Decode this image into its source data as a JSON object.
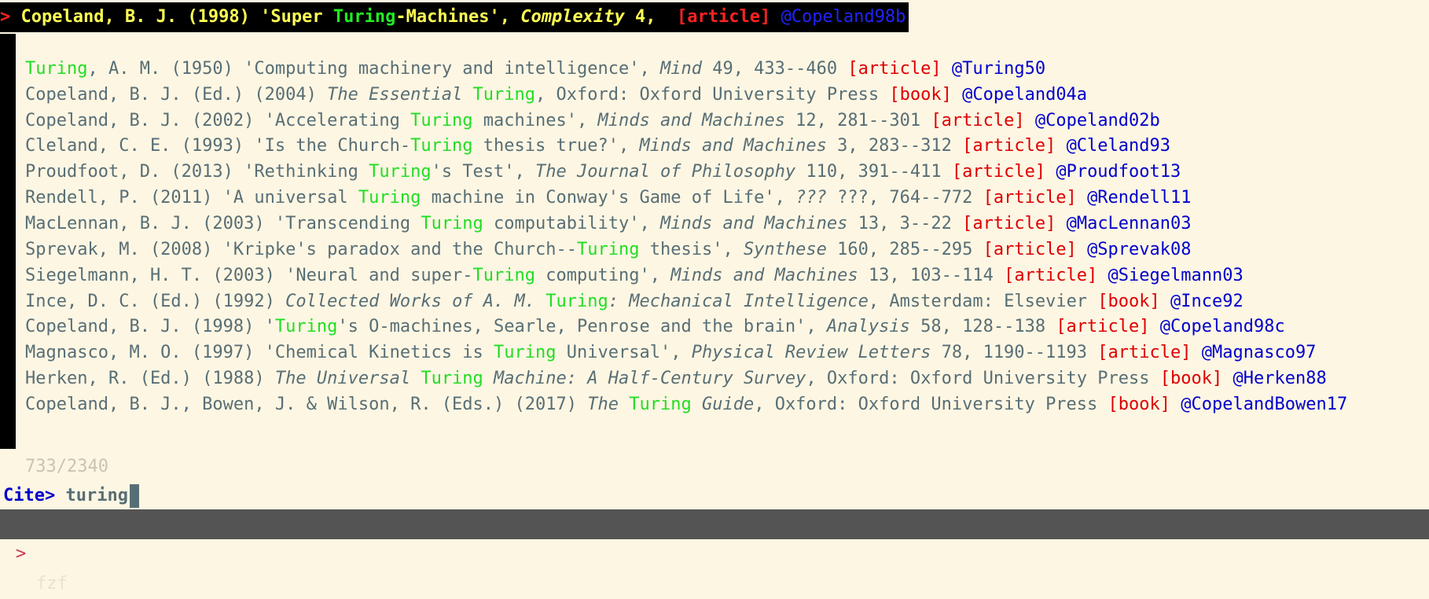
{
  "colors": {
    "background": "#fdf6e3",
    "selected_background": "#000000",
    "match_highlight": "#22dd22",
    "entry_type": "#dd0000",
    "cite_key": "#0000cc",
    "statusbar": "#545454"
  },
  "selected": {
    "pointer": ">",
    "author_year": "Copeland, B. J. (1998) 'Super ",
    "match": "Turing",
    "title_rest": "-Machines', ",
    "journal": "Complexity",
    "details": " 4,  ",
    "type": "[article]",
    "key": "@Copeland98b"
  },
  "results": [
    {
      "pre": "",
      "match": "Turing",
      "post": ", A. M. (1950) 'Computing machinery and intelligence', ",
      "it": "Mind",
      "tail": " 49, 433--460 ",
      "type": "[article]",
      "key": "@Turing50"
    },
    {
      "pre": "Copeland, B. J. (Ed.) (2004) ",
      "it_pre": "The Essential ",
      "match": "Turing",
      "post": ", Oxford: Oxford University Press ",
      "type": "[book]",
      "key": "@Copeland04a"
    },
    {
      "pre": "Copeland, B. J. (2002) 'Accelerating ",
      "match": "Turing",
      "post": " machines', ",
      "it": "Minds and Machines",
      "tail": " 12, 281--301 ",
      "type": "[article]",
      "key": "@Copeland02b"
    },
    {
      "pre": "Cleland, C. E. (1993) 'Is the Church-",
      "match": "Turing",
      "post": " thesis true?', ",
      "it": "Minds and Machines",
      "tail": " 3, 283--312 ",
      "type": "[article]",
      "key": "@Cleland93"
    },
    {
      "pre": "Proudfoot, D. (2013) 'Rethinking ",
      "match": "Turing",
      "post": "'s Test', ",
      "it": "The Journal of Philosophy",
      "tail": " 110, 391--411 ",
      "type": "[article]",
      "key": "@Proudfoot13"
    },
    {
      "pre": "Rendell, P. (2011) 'A universal ",
      "match": "Turing",
      "post": " machine in Conway's Game of Life', ",
      "it": "???",
      "tail": " ???, 764--772 ",
      "type": "[article]",
      "key": "@Rendell11"
    },
    {
      "pre": "MacLennan, B. J. (2003) 'Transcending ",
      "match": "Turing",
      "post": " computability', ",
      "it": "Minds and Machines",
      "tail": " 13, 3--22 ",
      "type": "[article]",
      "key": "@MacLennan03"
    },
    {
      "pre": "Sprevak, M. (2008) 'Kripke's paradox and the Church--",
      "match": "Turing",
      "post": " thesis', ",
      "it": "Synthese",
      "tail": " 160, 285--295 ",
      "type": "[article]",
      "key": "@Sprevak08"
    },
    {
      "pre": "Siegelmann, H. T. (2003) 'Neural and super-",
      "match": "Turing",
      "post": " computing', ",
      "it": "Minds and Machines",
      "tail": " 13, 103--114 ",
      "type": "[article]",
      "key": "@Siegelmann03"
    },
    {
      "pre": "Ince, D. C. (Ed.) (1992) ",
      "it_pre": "Collected Works of A. M. ",
      "match": "Turing",
      "it_post": ": Mechanical Intelligence",
      "post": ", Amsterdam: Elsevier ",
      "type": "[book]",
      "key": "@Ince92"
    },
    {
      "pre": "Copeland, B. J. (1998) '",
      "match": "Turing",
      "post": "'s O-machines, Searle, Penrose and the brain', ",
      "it": "Analysis",
      "tail": " 58, 128--138 ",
      "type": "[article]",
      "key": "@Copeland98c"
    },
    {
      "pre": "Magnasco, M. O. (1997) 'Chemical Kinetics is ",
      "match": "Turing",
      "post": " Universal', ",
      "it": "Physical Review Letters",
      "tail": " 78, 1190--1193 ",
      "type": "[article]",
      "key": "@Magnasco97"
    },
    {
      "pre": "Herken, R. (Ed.) (1988) ",
      "it_pre": "The Universal ",
      "match": "Turing",
      "it_post": " Machine: A Half-Century Survey",
      "post": ", Oxford: Oxford University Press ",
      "type": "[book]",
      "key": "@Herken88"
    },
    {
      "pre": "Copeland, B. J., Bowen, J. & Wilson, R. (Eds.) (2017) ",
      "it_pre": "The ",
      "match": "Turing",
      "it_post": " Guide",
      "post": ", Oxford: Oxford University Press ",
      "type": "[book]",
      "key": "@CopelandBowen17"
    }
  ],
  "counter": "733/2340",
  "prompt": {
    "label": "Cite>",
    "query": "turing"
  },
  "statusbar": {
    "pointer": ">",
    "label": "fzf"
  }
}
